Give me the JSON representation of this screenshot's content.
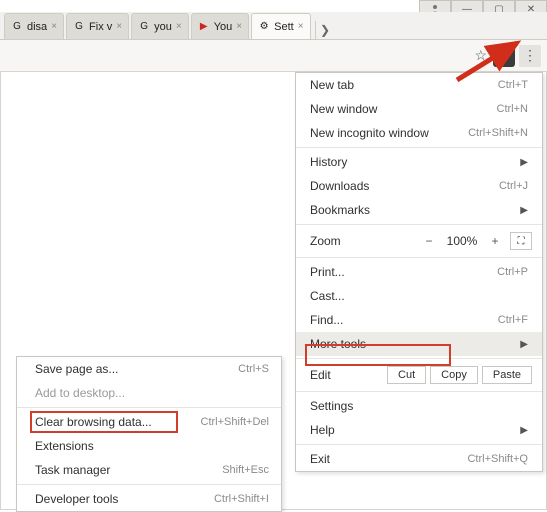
{
  "window_controls": {
    "user": "",
    "min": "—",
    "max": "▢",
    "close": "✕"
  },
  "tabs": [
    {
      "favicon": "G",
      "title": "disa",
      "active": false
    },
    {
      "favicon": "G",
      "title": "Fix v",
      "active": false
    },
    {
      "favicon": "G",
      "title": "you",
      "active": false
    },
    {
      "favicon": "▶",
      "title": "You",
      "active": false
    },
    {
      "favicon": "⚙",
      "title": "Sett",
      "active": true
    }
  ],
  "toolbar": {
    "star": "☆",
    "ext": "⋯",
    "menu": "⋮"
  },
  "main_menu": {
    "new_tab": {
      "label": "New tab",
      "shortcut": "Ctrl+T"
    },
    "new_window": {
      "label": "New window",
      "shortcut": "Ctrl+N"
    },
    "new_incognito": {
      "label": "New incognito window",
      "shortcut": "Ctrl+Shift+N"
    },
    "history": {
      "label": "History"
    },
    "downloads": {
      "label": "Downloads",
      "shortcut": "Ctrl+J"
    },
    "bookmarks": {
      "label": "Bookmarks"
    },
    "zoom": {
      "label": "Zoom",
      "minus": "−",
      "value": "100%",
      "plus": "+"
    },
    "print": {
      "label": "Print...",
      "shortcut": "Ctrl+P"
    },
    "cast": {
      "label": "Cast..."
    },
    "find": {
      "label": "Find...",
      "shortcut": "Ctrl+F"
    },
    "more_tools": {
      "label": "More tools"
    },
    "edit": {
      "label": "Edit",
      "cut": "Cut",
      "copy": "Copy",
      "paste": "Paste"
    },
    "settings": {
      "label": "Settings"
    },
    "help": {
      "label": "Help"
    },
    "exit": {
      "label": "Exit",
      "shortcut": "Ctrl+Shift+Q"
    }
  },
  "sub_menu": {
    "save_page": {
      "label": "Save page as...",
      "shortcut": "Ctrl+S"
    },
    "add_desktop": {
      "label": "Add to desktop..."
    },
    "clear_data": {
      "label": "Clear browsing data...",
      "shortcut": "Ctrl+Shift+Del"
    },
    "extensions": {
      "label": "Extensions"
    },
    "task_mgr": {
      "label": "Task manager",
      "shortcut": "Shift+Esc"
    },
    "dev_tools": {
      "label": "Developer tools",
      "shortcut": "Ctrl+Shift+I"
    }
  }
}
